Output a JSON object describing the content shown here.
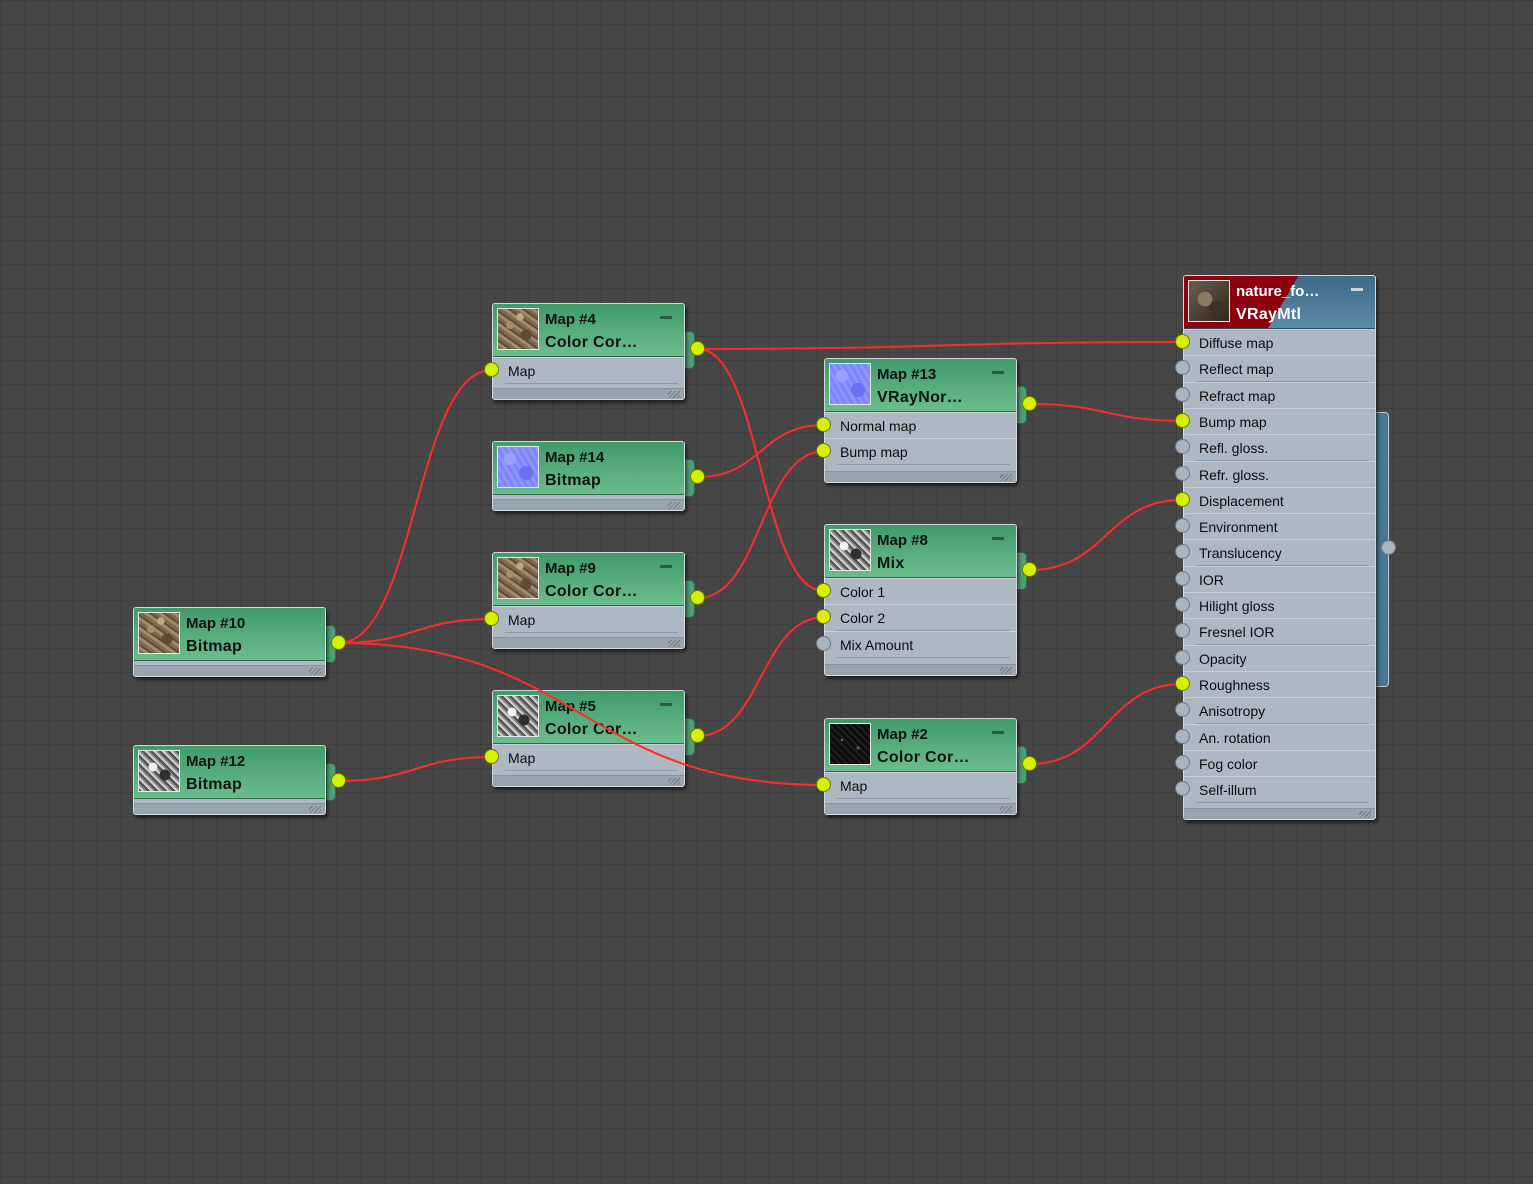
{
  "colors": {
    "canvas": "#464646",
    "map_header": "#5aaf80",
    "material_header": "#4a7896",
    "material_badge": "#8c0010",
    "wire": "#ff2a2a",
    "socket_connected": "#d6f000",
    "socket_free": "#a9b4bf"
  },
  "nodes": {
    "map10": {
      "name": "Map #10",
      "type": "Bitmap",
      "thumbnail": "bark-texture",
      "slots": []
    },
    "map12": {
      "name": "Map #12",
      "type": "Bitmap",
      "thumbnail": "grayscale-noise",
      "slots": []
    },
    "map4": {
      "name": "Map #4",
      "type": "Color Cor…",
      "thumbnail": "bark-texture",
      "slots": [
        {
          "label": "Map",
          "connected": true
        }
      ]
    },
    "map14": {
      "name": "Map #14",
      "type": "Bitmap",
      "thumbnail": "normal-map",
      "slots": []
    },
    "map9": {
      "name": "Map #9",
      "type": "Color Cor…",
      "thumbnail": "bark-texture",
      "slots": [
        {
          "label": "Map",
          "connected": true
        }
      ]
    },
    "map5": {
      "name": "Map #5",
      "type": "Color Cor…",
      "thumbnail": "grayscale-noise",
      "slots": [
        {
          "label": "Map",
          "connected": true
        }
      ]
    },
    "map13": {
      "name": "Map #13",
      "type": "VRayNor…",
      "thumbnail": "normal-map",
      "slots": [
        {
          "label": "Normal map",
          "connected": true
        },
        {
          "label": "Bump map",
          "connected": true
        }
      ]
    },
    "map8": {
      "name": "Map #8",
      "type": "Mix",
      "thumbnail": "grayscale-noise",
      "slots": [
        {
          "label": "Color 1",
          "connected": true
        },
        {
          "label": "Color 2",
          "connected": true
        },
        {
          "label": "Mix Amount",
          "connected": false
        }
      ]
    },
    "map2": {
      "name": "Map #2",
      "type": "Color Cor…",
      "thumbnail": "dark-noise",
      "slots": [
        {
          "label": "Map",
          "connected": true
        }
      ]
    },
    "mtl": {
      "name": "nature_fo…",
      "type": "VRayMtl",
      "thumbnail": "rock-texture",
      "slots": [
        {
          "label": "Diffuse map",
          "connected": true
        },
        {
          "label": "Reflect map",
          "connected": false
        },
        {
          "label": "Refract map",
          "connected": false
        },
        {
          "label": "Bump map",
          "connected": true
        },
        {
          "label": "Refl. gloss.",
          "connected": false
        },
        {
          "label": "Refr. gloss.",
          "connected": false
        },
        {
          "label": "Displacement",
          "connected": true
        },
        {
          "label": "Environment",
          "connected": false
        },
        {
          "label": "Translucency",
          "connected": false
        },
        {
          "label": "IOR",
          "connected": false
        },
        {
          "label": "Hilight gloss",
          "connected": false
        },
        {
          "label": "Fresnel IOR",
          "connected": false
        },
        {
          "label": "Opacity",
          "connected": false
        },
        {
          "label": "Roughness",
          "connected": true
        },
        {
          "label": "Anisotropy",
          "connected": false
        },
        {
          "label": "An. rotation",
          "connected": false
        },
        {
          "label": "Fog color",
          "connected": false
        },
        {
          "label": "Self-illum",
          "connected": false
        }
      ]
    }
  },
  "wires": [
    {
      "from": "map10",
      "to": "map4",
      "slot": "Map"
    },
    {
      "from": "map10",
      "to": "map9",
      "slot": "Map"
    },
    {
      "from": "map10",
      "to": "map2",
      "slot": "Map"
    },
    {
      "from": "map12",
      "to": "map5",
      "slot": "Map"
    },
    {
      "from": "map4",
      "to": "mtl",
      "slot": "Diffuse map"
    },
    {
      "from": "map4",
      "to": "map8",
      "slot": "Color 1"
    },
    {
      "from": "map14",
      "to": "map13",
      "slot": "Normal map"
    },
    {
      "from": "map9",
      "to": "map13",
      "slot": "Bump map"
    },
    {
      "from": "map5",
      "to": "map8",
      "slot": "Color 2"
    },
    {
      "from": "map13",
      "to": "mtl",
      "slot": "Bump map"
    },
    {
      "from": "map8",
      "to": "mtl",
      "slot": "Displacement"
    },
    {
      "from": "map2",
      "to": "mtl",
      "slot": "Roughness"
    }
  ]
}
